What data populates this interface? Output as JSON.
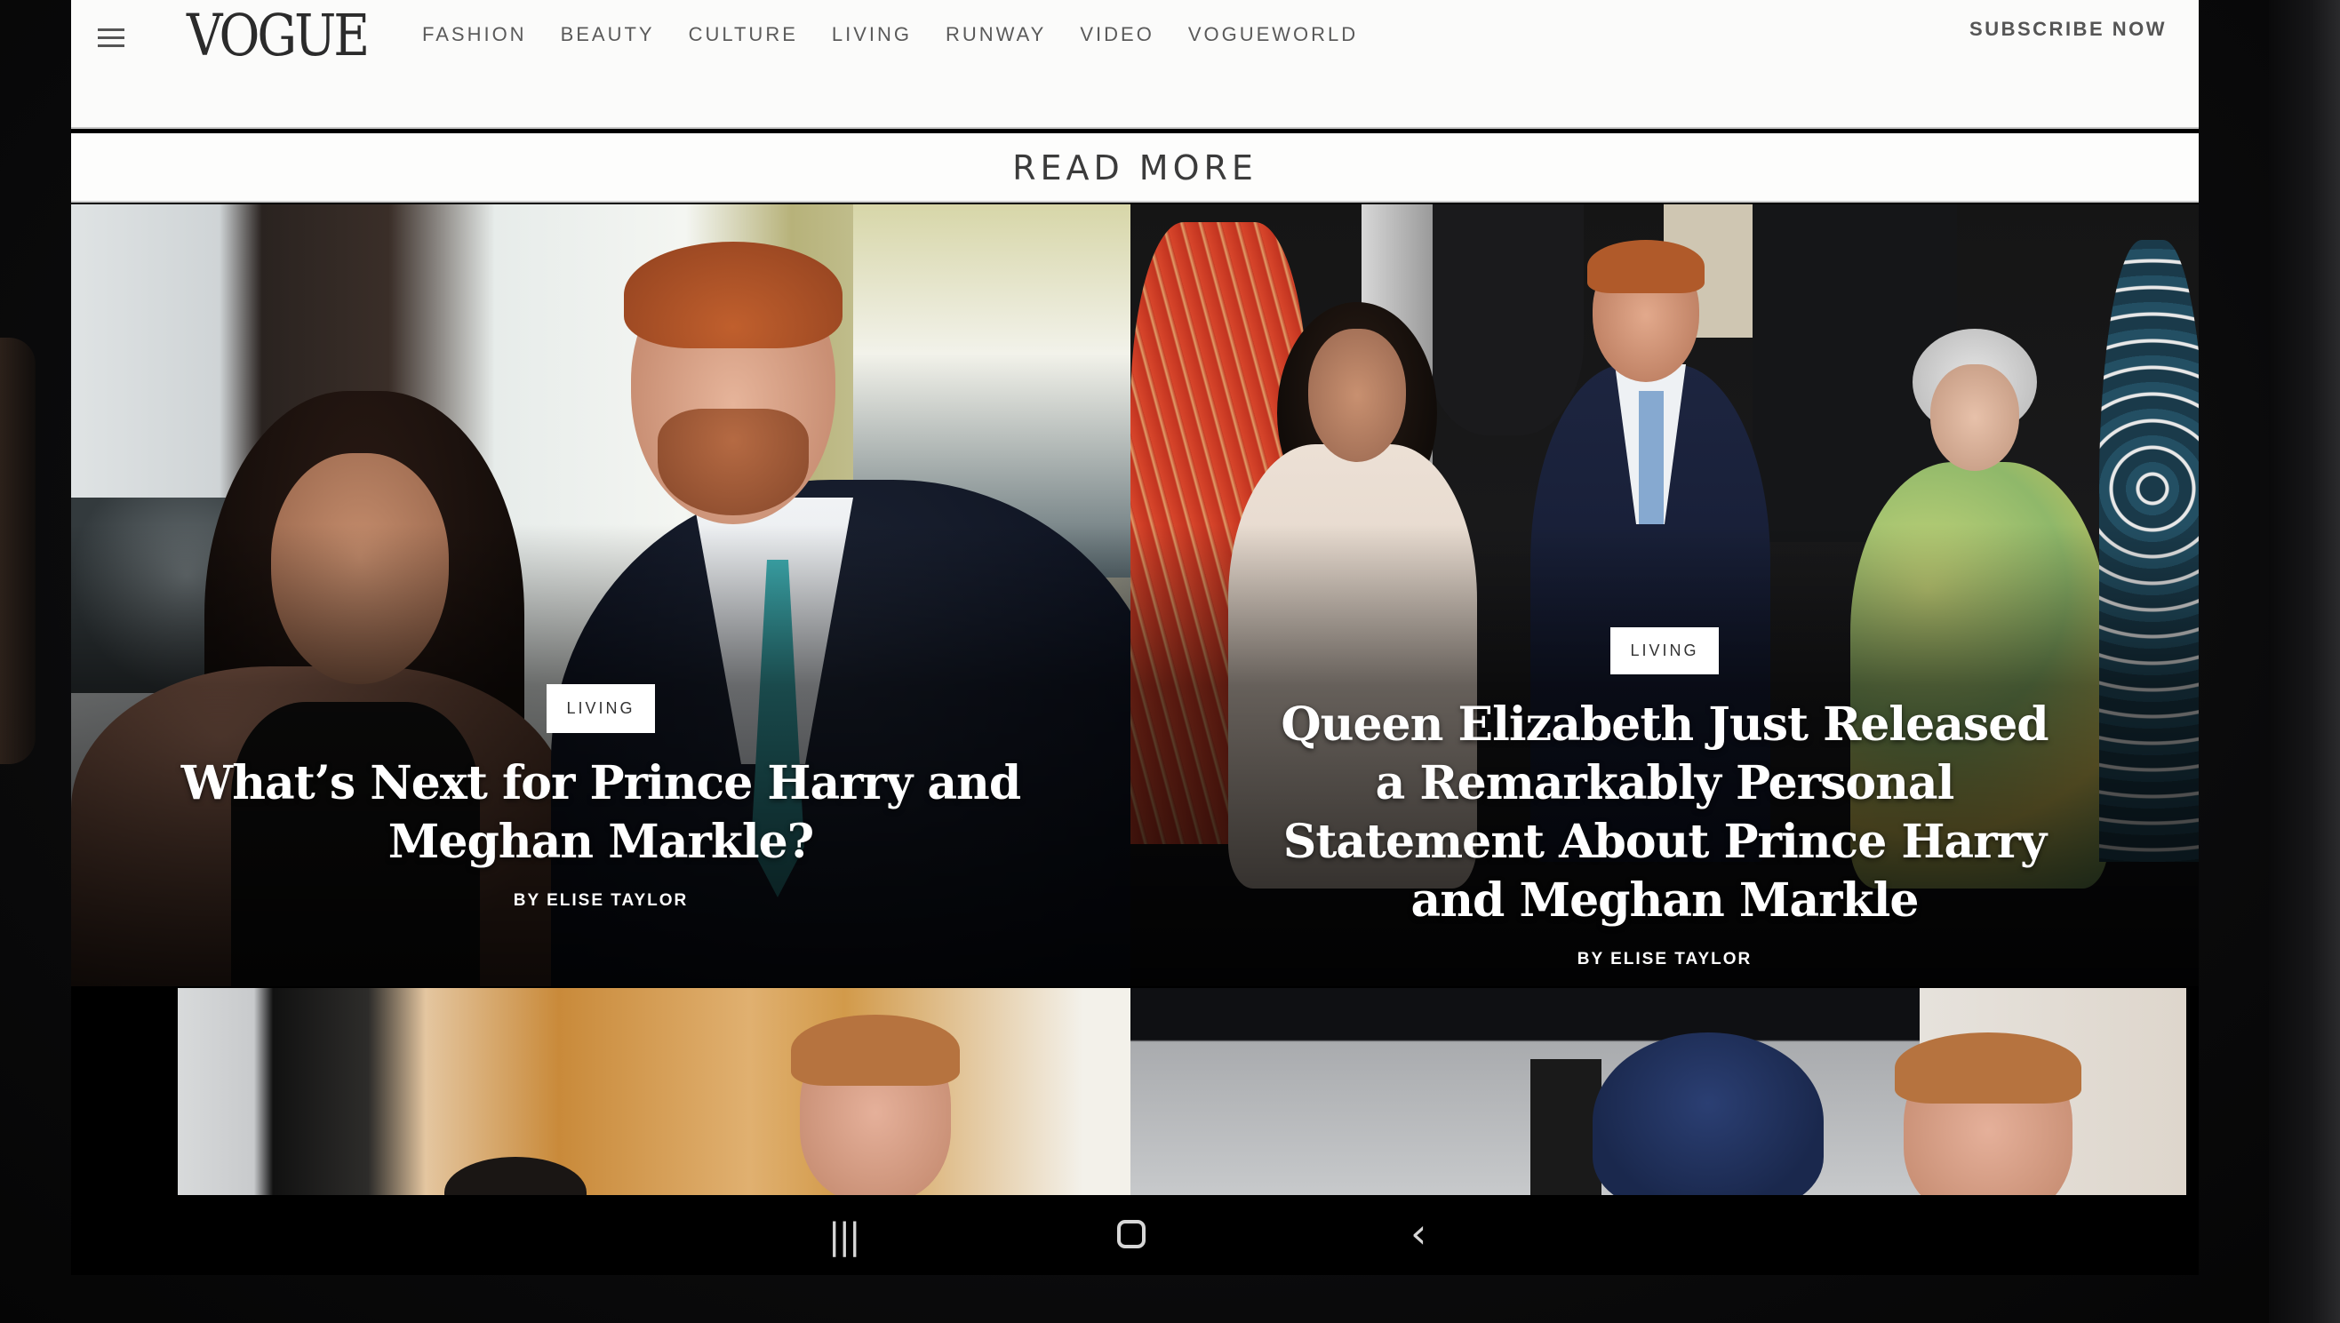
{
  "header": {
    "logo": "VOGUE",
    "nav_items": [
      "FASHION",
      "BEAUTY",
      "CULTURE",
      "LIVING",
      "RUNWAY",
      "VIDEO",
      "VOGUEWORLD"
    ],
    "subscribe_label": "SUBSCRIBE NOW",
    "menu_icon": "hamburger-menu-icon"
  },
  "section": {
    "title": "READ MORE"
  },
  "articles": [
    {
      "category": "LIVING",
      "headline": "What’s Next for Prince Harry and Meghan Markle?",
      "byline": "BY ELISE TAYLOR"
    },
    {
      "category": "LIVING",
      "headline": "Queen Elizabeth Just Released a Remarkably Personal Statement About Prince Harry and Meghan Markle",
      "byline": "BY ELISE TAYLOR"
    }
  ],
  "system_nav": {
    "recent_icon": "recent-apps-icon",
    "recent_glyph": "|||",
    "home_icon": "home-icon",
    "back_icon": "back-icon",
    "back_glyph": "‹"
  }
}
